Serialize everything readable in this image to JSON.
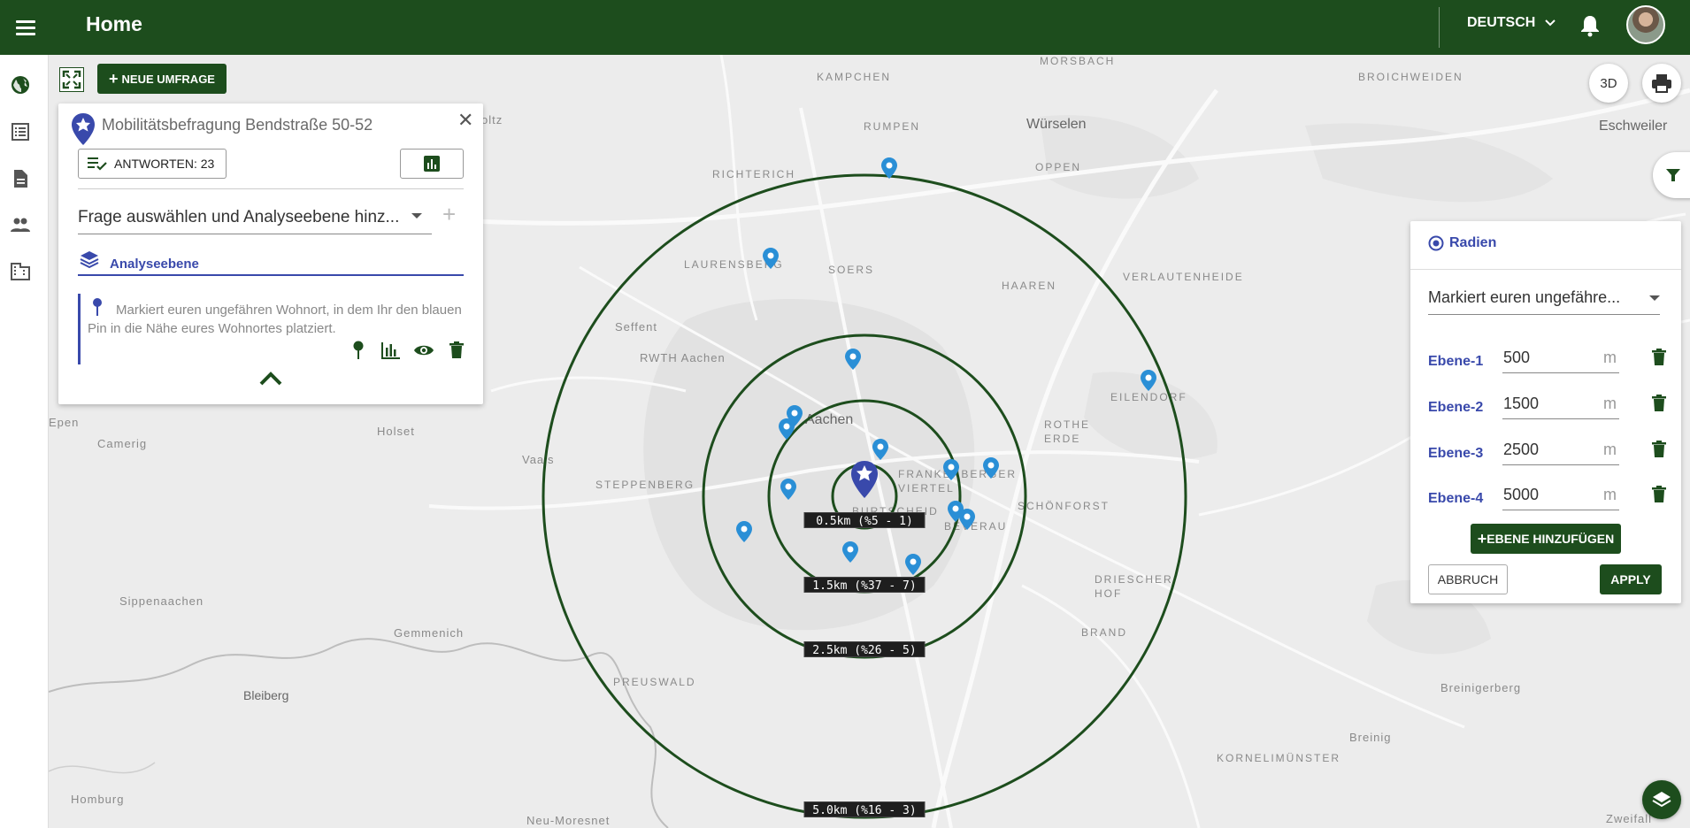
{
  "header": {
    "title": "Home",
    "language": "DEUTSCH"
  },
  "toolbar": {
    "new_survey_label": "NEUE UMFRAGE"
  },
  "survey_panel": {
    "title": "Mobilitätsbefragung Bendstraße 50-52",
    "answers_label": "ANTWORTEN: 23",
    "question_select": "Frage auswählen und Analyseebene hinz...",
    "analysis_label": "Analyseebene",
    "layer_text": "Markiert euren ungefähren Wohnort, in dem Ihr den blauen Pin in die Nähe eures Wohnortes platziert."
  },
  "map_controls": {
    "three_d_label": "3D"
  },
  "radius_panel": {
    "title": "Radien",
    "question_select": "Markiert euren ungefähre...",
    "unit": "m",
    "levels": [
      {
        "name": "Ebene-1",
        "value": "500"
      },
      {
        "name": "Ebene-2",
        "value": "1500"
      },
      {
        "name": "Ebene-3",
        "value": "2500"
      },
      {
        "name": "Ebene-4",
        "value": "5000"
      }
    ],
    "add_level_label": "EBENE HINZUFÜGEN",
    "abort_label": "ABBRUCH",
    "apply_label": "APPLY"
  },
  "rings": [
    {
      "label": "0.5km (%5 - 1)"
    },
    {
      "label": "1.5km (%37 - 7)"
    },
    {
      "label": "2.5km (%26 - 5)"
    },
    {
      "label": "5.0km (%16 - 3)"
    }
  ],
  "map_labels": [
    "Morsbach",
    "Broichweiden",
    "Kampchen",
    "Würselen",
    "Eschweiler",
    "Rumpen",
    "Oppen",
    "Richterich",
    "Laurensberg",
    "Soers",
    "Haaren",
    "Verlautenheide",
    "Seffent",
    "RWTH Aachen",
    "Eilendorf",
    "Aachen",
    "Rothe Erde",
    "Holset",
    "Camerig",
    "Vaals",
    "Steppenberg",
    "Frankenberger Viertel",
    "Burtscheid",
    "Beverau",
    "Schönforst",
    "Driescher Hof",
    "Sippenaachen",
    "Gemmenich",
    "Brand",
    "Preuswald",
    "Bleiberg",
    "Breinigerberg",
    "Kornelimünster",
    "Homburg",
    "Neu-Moresnet",
    "Breinig",
    "Zweifall",
    "Epen",
    "oltz"
  ],
  "colors": {
    "brand": "#1d4d1d",
    "accent": "#3949ab",
    "pin": "#2a8fd6"
  }
}
